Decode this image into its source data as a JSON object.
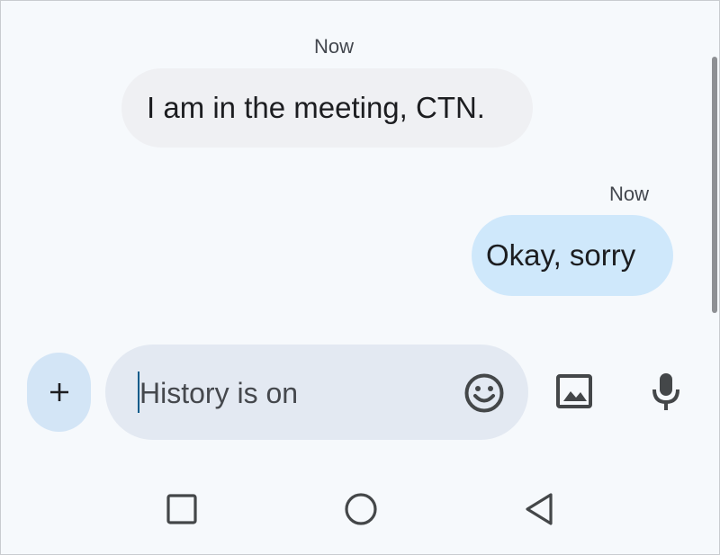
{
  "conversation": {
    "incoming": {
      "timestamp": "Now",
      "text": "I am in the meeting, CTN."
    },
    "outgoing": {
      "timestamp": "Now",
      "text": "Okay, sorry"
    }
  },
  "composer": {
    "add_icon": "plus-icon",
    "placeholder": "History is on",
    "value": "",
    "emoji_icon": "emoji-icon",
    "gallery_icon": "image-icon",
    "voice_icon": "mic-icon"
  },
  "navbar": {
    "recents_icon": "square-icon",
    "home_icon": "circle-icon",
    "back_icon": "triangle-back-icon"
  },
  "colors": {
    "background": "#f6f9fc",
    "incoming_bubble": "#eff0f3",
    "outgoing_bubble": "#cfe8fb",
    "compose_field": "#e3e9f2",
    "add_button": "#d3e5f6",
    "icon": "#444749"
  }
}
